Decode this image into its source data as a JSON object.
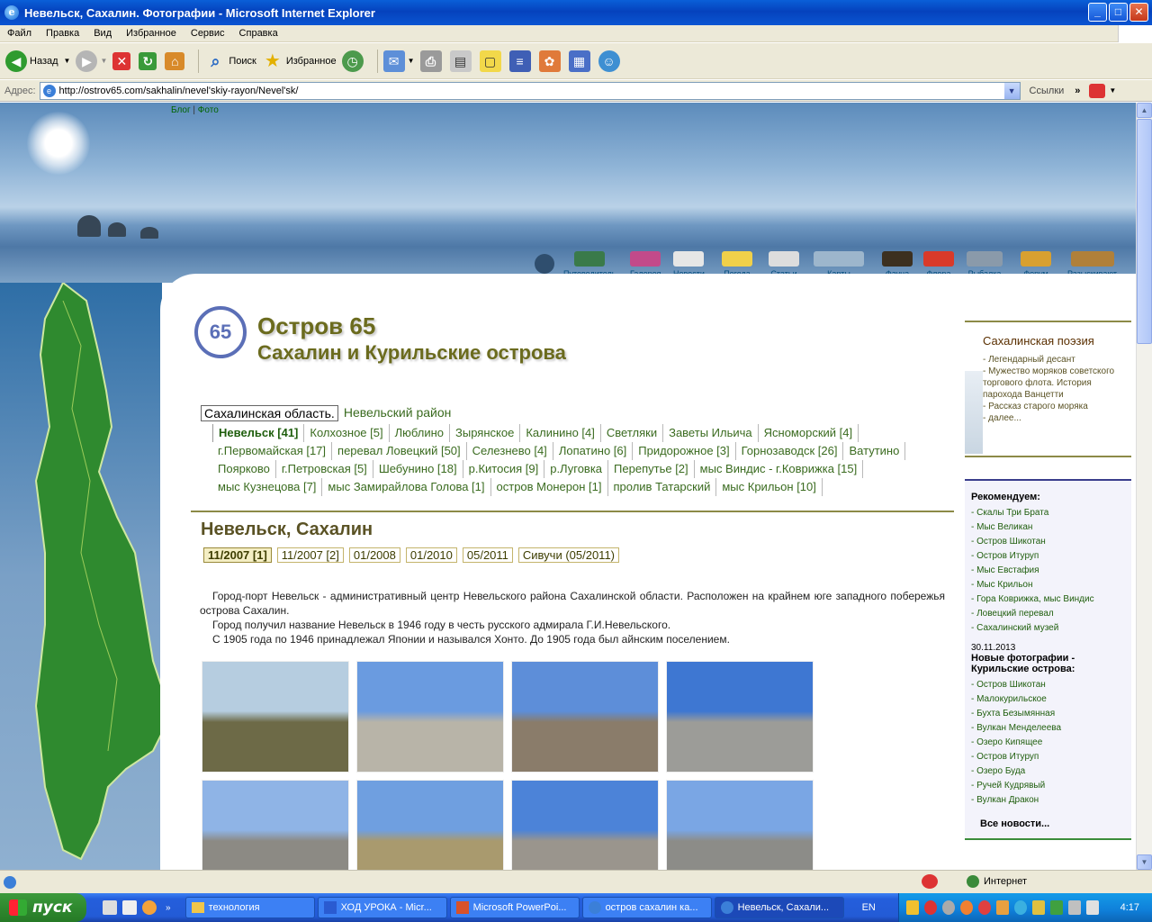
{
  "window": {
    "title": "Невельск, Сахалин. Фотографии - Microsoft Internet Explorer",
    "min": "_",
    "max": "□",
    "close": "✕"
  },
  "menu": [
    "Файл",
    "Правка",
    "Вид",
    "Избранное",
    "Сервис",
    "Справка"
  ],
  "toolbar": {
    "back": "Назад",
    "search": "Поиск",
    "favorites": "Избранное"
  },
  "address": {
    "label": "Адрес:",
    "url": "http://ostrov65.com/sakhalin/nevel'skiy-rayon/Nevel'sk/",
    "links": "Ссылки"
  },
  "top_links": {
    "blog": "Блог",
    "sep": "|",
    "photo": "Фото"
  },
  "nav": [
    "Путеводитель",
    "Галерея",
    "Новости",
    "Погода",
    "Статьи",
    "Карты",
    "Фауна",
    "Флора",
    "Рыбалка",
    "Форум",
    "Разыскивают"
  ],
  "site": {
    "logo_number": "65",
    "name": "Остров 65",
    "subtitle": "Сахалин и Курильские острова"
  },
  "breadcrumb": {
    "region": "Сахалинская область.",
    "district": "Невельский район"
  },
  "places": [
    "Невельск [41]",
    "Колхозное [5]",
    "Люблино",
    "Зырянское",
    "Калинино [4]",
    "Светляки",
    "Заветы Ильича",
    "Ясноморский [4]",
    "г.Первомайская [17]",
    "перевал Ловецкий [50]",
    "Селезнево [4]",
    "Лопатино [6]",
    "Придорожное [3]",
    "Горнозаводск [26]",
    "Ватутино",
    "Поярково",
    "г.Петровская [5]",
    "Шебунино [18]",
    "р.Китосия [9]",
    "р.Луговка",
    "Перепутье [2]",
    "мыс Виндис - г.Коврижка [15]",
    "мыс Кузнецова [7]",
    "мыс Замирайлова Голова [1]",
    "остров Монерон [1]",
    "пролив Татарский",
    "мыс Крильон [10]"
  ],
  "page": {
    "title": "Невельск, Сахалин",
    "dates": [
      "11/2007 [1]",
      "11/2007 [2]",
      "01/2008",
      "01/2010",
      "05/2011",
      "Сивучи (05/2011)"
    ],
    "paragraphs": [
      "Город-порт Невельск - административный центр Невельского района Сахалинской области. Расположен на крайнем юге западного побережья острова Сахалин.",
      "Город получил название Невельск в 1946 году в честь русского адмирала Г.И.Невельского.",
      "С 1905 года по 1946 принадлежал Японии и назывался Хонто. До 1905 года был айнским поселением."
    ]
  },
  "photos": [
    {
      "colors": [
        "#b6cde0",
        "#6d6a47"
      ]
    },
    {
      "colors": [
        "#6a9be0",
        "#b8b4a8"
      ]
    },
    {
      "colors": [
        "#5d8ed9",
        "#8a7c6a"
      ]
    },
    {
      "colors": [
        "#3e77d2",
        "#9c9c98"
      ]
    },
    {
      "colors": [
        "#8fb4e6",
        "#8c8a84"
      ]
    },
    {
      "colors": [
        "#6f9fe0",
        "#a99a6e"
      ]
    },
    {
      "colors": [
        "#4c83d8",
        "#9a958d"
      ]
    },
    {
      "colors": [
        "#7aa6e4",
        "#8c8c88"
      ]
    }
  ],
  "poetry": {
    "title": "Сахалинская поэзия",
    "items": [
      "- Легендарный десант",
      "- Мужество моряков советского торгового флота. История парохода Ванцетти",
      "- Рассказ старого моряка",
      "- далее..."
    ]
  },
  "recommend": {
    "title": "Рекомендуем:",
    "items": [
      "- Скалы Три Брата",
      "- Мыс Великан",
      "- Остров Шикотан",
      "- Остров Итуруп",
      "- Мыс Евстафия",
      "- Мыс Крильон",
      "- Гора Коврижка, мыс Виндис",
      "- Ловецкий перевал",
      "- Сахалинский музей"
    ],
    "date": "30.11.2013",
    "news_title": "Новые фотографии - Курильские острова:",
    "news": [
      "- Остров Шикотан",
      "- Малокурильское",
      "- Бухта Безымянная",
      "- Вулкан Менделеева",
      "- Озеро Кипящее",
      "- Остров Итуруп",
      "- Озеро Буда",
      "- Ручей Кудрявый",
      "- Вулкан Дракон"
    ],
    "more": "Все новости..."
  },
  "status": {
    "zone": "Интернет"
  },
  "taskbar": {
    "start": "пуск",
    "tasks": [
      "технология",
      "ХОД УРОКА - Micr...",
      "Microsoft PowerPoi...",
      "остров сахалин ка...",
      "Невельск, Сахали..."
    ],
    "lang": "EN",
    "clock": "4:17"
  }
}
